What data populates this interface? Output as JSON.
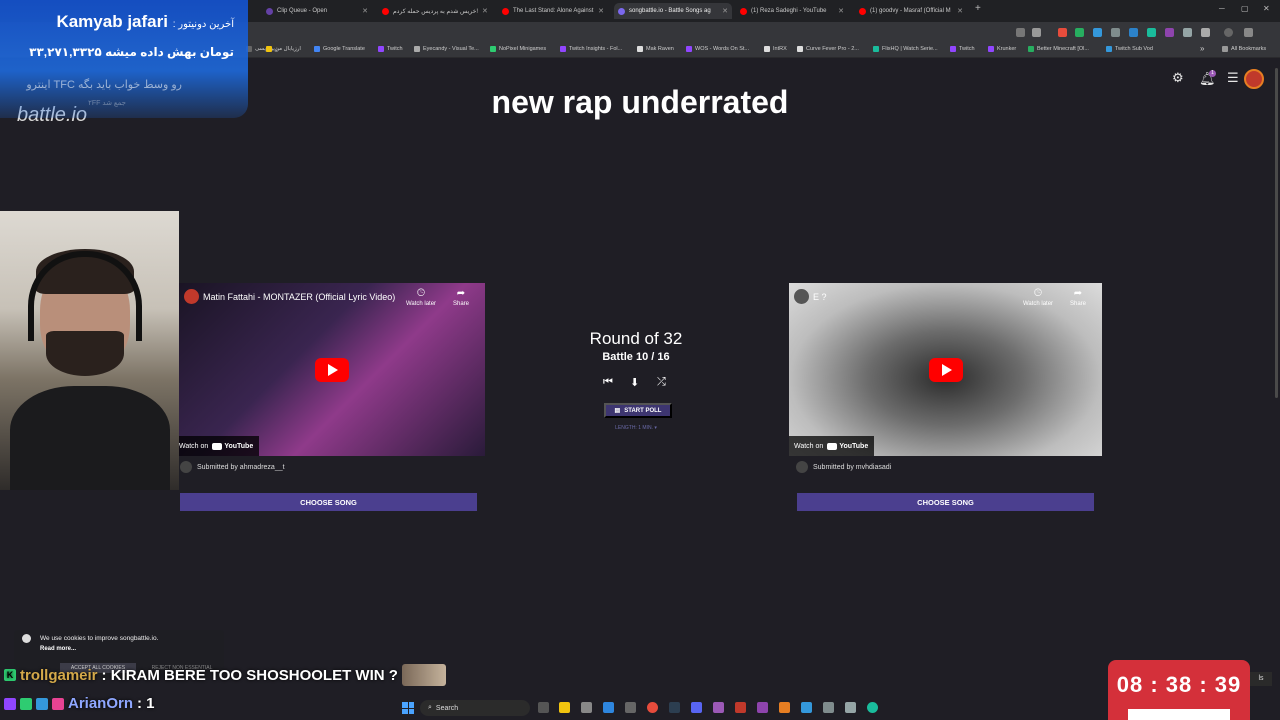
{
  "browser": {
    "tabs": [
      {
        "label": "Clip Queue - Open",
        "color": "#6441a5"
      },
      {
        "label": "خریس شدم به پردیس حمله کردم!",
        "color": "#ff0000"
      },
      {
        "label": "The Last Stand: Alone Against",
        "color": "#ff0000"
      },
      {
        "label": "songbattle.io - Battle Songs ag",
        "color": "#7b68ee"
      },
      {
        "label": "(1) Reza Sadeghi - YouTube",
        "color": "#ff0000"
      },
      {
        "label": "(1) goodvy - Masraf (Official M",
        "color": "#ff0000"
      }
    ],
    "new_tab": "+",
    "bookmarks": [
      "زیرنویسی",
      "ارزیابال من",
      "Google Translate",
      "Twitch",
      "Eyecandy - Visual Te...",
      "NoPixel Minigames",
      "Twitch Insights - Fol...",
      "Mak Raven",
      "WOS - Words On St...",
      "IntRX",
      "Curve Fever Pro - 2...",
      "FlixHQ | Watch Serie...",
      "Twitch",
      "Krunker",
      "Better Minecraft [Ol...",
      "Twitch Sub Vod"
    ],
    "all_bookmarks": "All Bookmarks"
  },
  "page": {
    "logo": "battle.io",
    "title": "new rap underrated",
    "notif_count": "1"
  },
  "left_song": {
    "title": "Matin Fattahi - MONTAZER (Official Lyric Video)",
    "watch_later": "Watch later",
    "share": "Share",
    "watch_on": "Watch on",
    "youtube": "YouTube",
    "submitted_by": "Submitted by ahmadreza__t",
    "choose": "CHOOSE SONG"
  },
  "right_song": {
    "title": "E ?",
    "watch_later": "Watch later",
    "share": "Share",
    "watch_on": "Watch on",
    "youtube": "YouTube",
    "submitted_by": "Submitted by mvhdiasadi",
    "choose": "CHOOSE SONG"
  },
  "center": {
    "round": "Round of 32",
    "battle": "Battle 10 / 16",
    "start_poll": "START POLL",
    "poll_length": "LENGTH: 1 MIN. ▾"
  },
  "donation": {
    "name": "Kamyab jafari",
    "label": ": آخرین دونیتور",
    "amount": "۳۳,۲۷۱,۳۳۲۵ تومان بهش داده میشه",
    "message": "اینترو TFC رو وسط خواب باید بگه",
    "message2": "۲FF جمع شد"
  },
  "cookie": {
    "text": "We use cookies to improve songbattle.io.",
    "read_more": "Read more...",
    "accept": "ACCEPT ALL COOKIES",
    "reject": "REJECT NON ESSENTIAL"
  },
  "chat": [
    {
      "badge": "K",
      "user": "trollgameir",
      "message": ": KIRAM BERE TOO SHOSHOOLET WIN ?"
    },
    {
      "user": "ArianOrn",
      "message": ": 1"
    }
  ],
  "taskbar": {
    "search": "Search"
  },
  "timer": {
    "value": "08 : 38 : 39"
  },
  "corner_tag": "ls"
}
